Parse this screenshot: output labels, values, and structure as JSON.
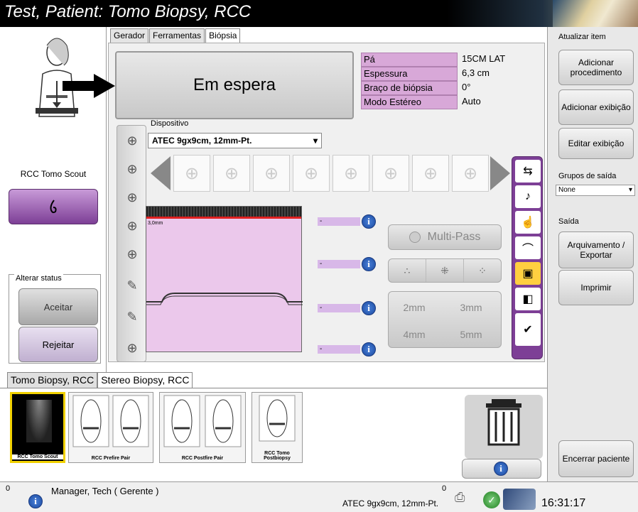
{
  "window": {
    "title": "Test, Patient:  Tomo Biopsy, RCC"
  },
  "left_panel": {
    "protocol_label": "RCC Tomo Scout",
    "status_group_label": "Alterar status",
    "accept_label": "Aceitar",
    "reject_label": "Rejeitar"
  },
  "tabs": [
    {
      "label": "Gerador",
      "active": false
    },
    {
      "label": "Ferramentas",
      "active": false
    },
    {
      "label": "Biópsia",
      "active": true
    }
  ],
  "biopsy": {
    "status_text": "Em espera",
    "info": [
      {
        "label": "Pá",
        "value": "15CM LAT"
      },
      {
        "label": "Espessura",
        "value": "6,3 cm"
      },
      {
        "label": "Braço de biópsia",
        "value": "0°"
      },
      {
        "label": "Modo Estéreo",
        "value": "Auto"
      }
    ],
    "device_legend": "Dispositivo",
    "device_value": "ATEC 9gx9cm, 12mm-Pt.",
    "needle_depth_label": "3,0mm",
    "needle_slots": [
      "-",
      "-",
      "-",
      "-"
    ],
    "multipass_label": "Multi-Pass",
    "step_options": [
      "2mm",
      "3mm",
      "4mm",
      "5mm"
    ]
  },
  "right_panel": {
    "update_item_label": "Atualizar item",
    "add_procedure_label": "Adicionar procedimento",
    "add_view_label": "Adicionar exibição",
    "edit_view_label": "Editar exibição",
    "output_groups_label": "Grupos de saída",
    "output_groups_value": "None",
    "output_label": "Saída",
    "archive_label": "Arquivamento / Exportar",
    "print_label": "Imprimir",
    "close_patient_label": "Encerrar paciente"
  },
  "procedure_tabs": [
    "Tomo Biopsy, RCC",
    "Stereo Biopsy, RCC"
  ],
  "thumbnails": [
    {
      "label": "RCC Tomo Scout",
      "selected": true
    },
    {
      "label": "RCC Prefire Pair",
      "selected": false
    },
    {
      "label": "RCC Postfire Pair",
      "selected": false
    },
    {
      "label": "RCC Tomo Postbiopsy",
      "selected": false
    }
  ],
  "status_bar": {
    "left_count": "0",
    "user": "Manager, Tech ( Gerente )",
    "device": "ATEC 9gx9cm, 12mm-Pt.",
    "right_count": "0",
    "time": "16:31:17"
  },
  "colors": {
    "accent_purple": "#7d3f96",
    "info_label_bg": "#d8a8d8",
    "title_bg": "#000000"
  }
}
